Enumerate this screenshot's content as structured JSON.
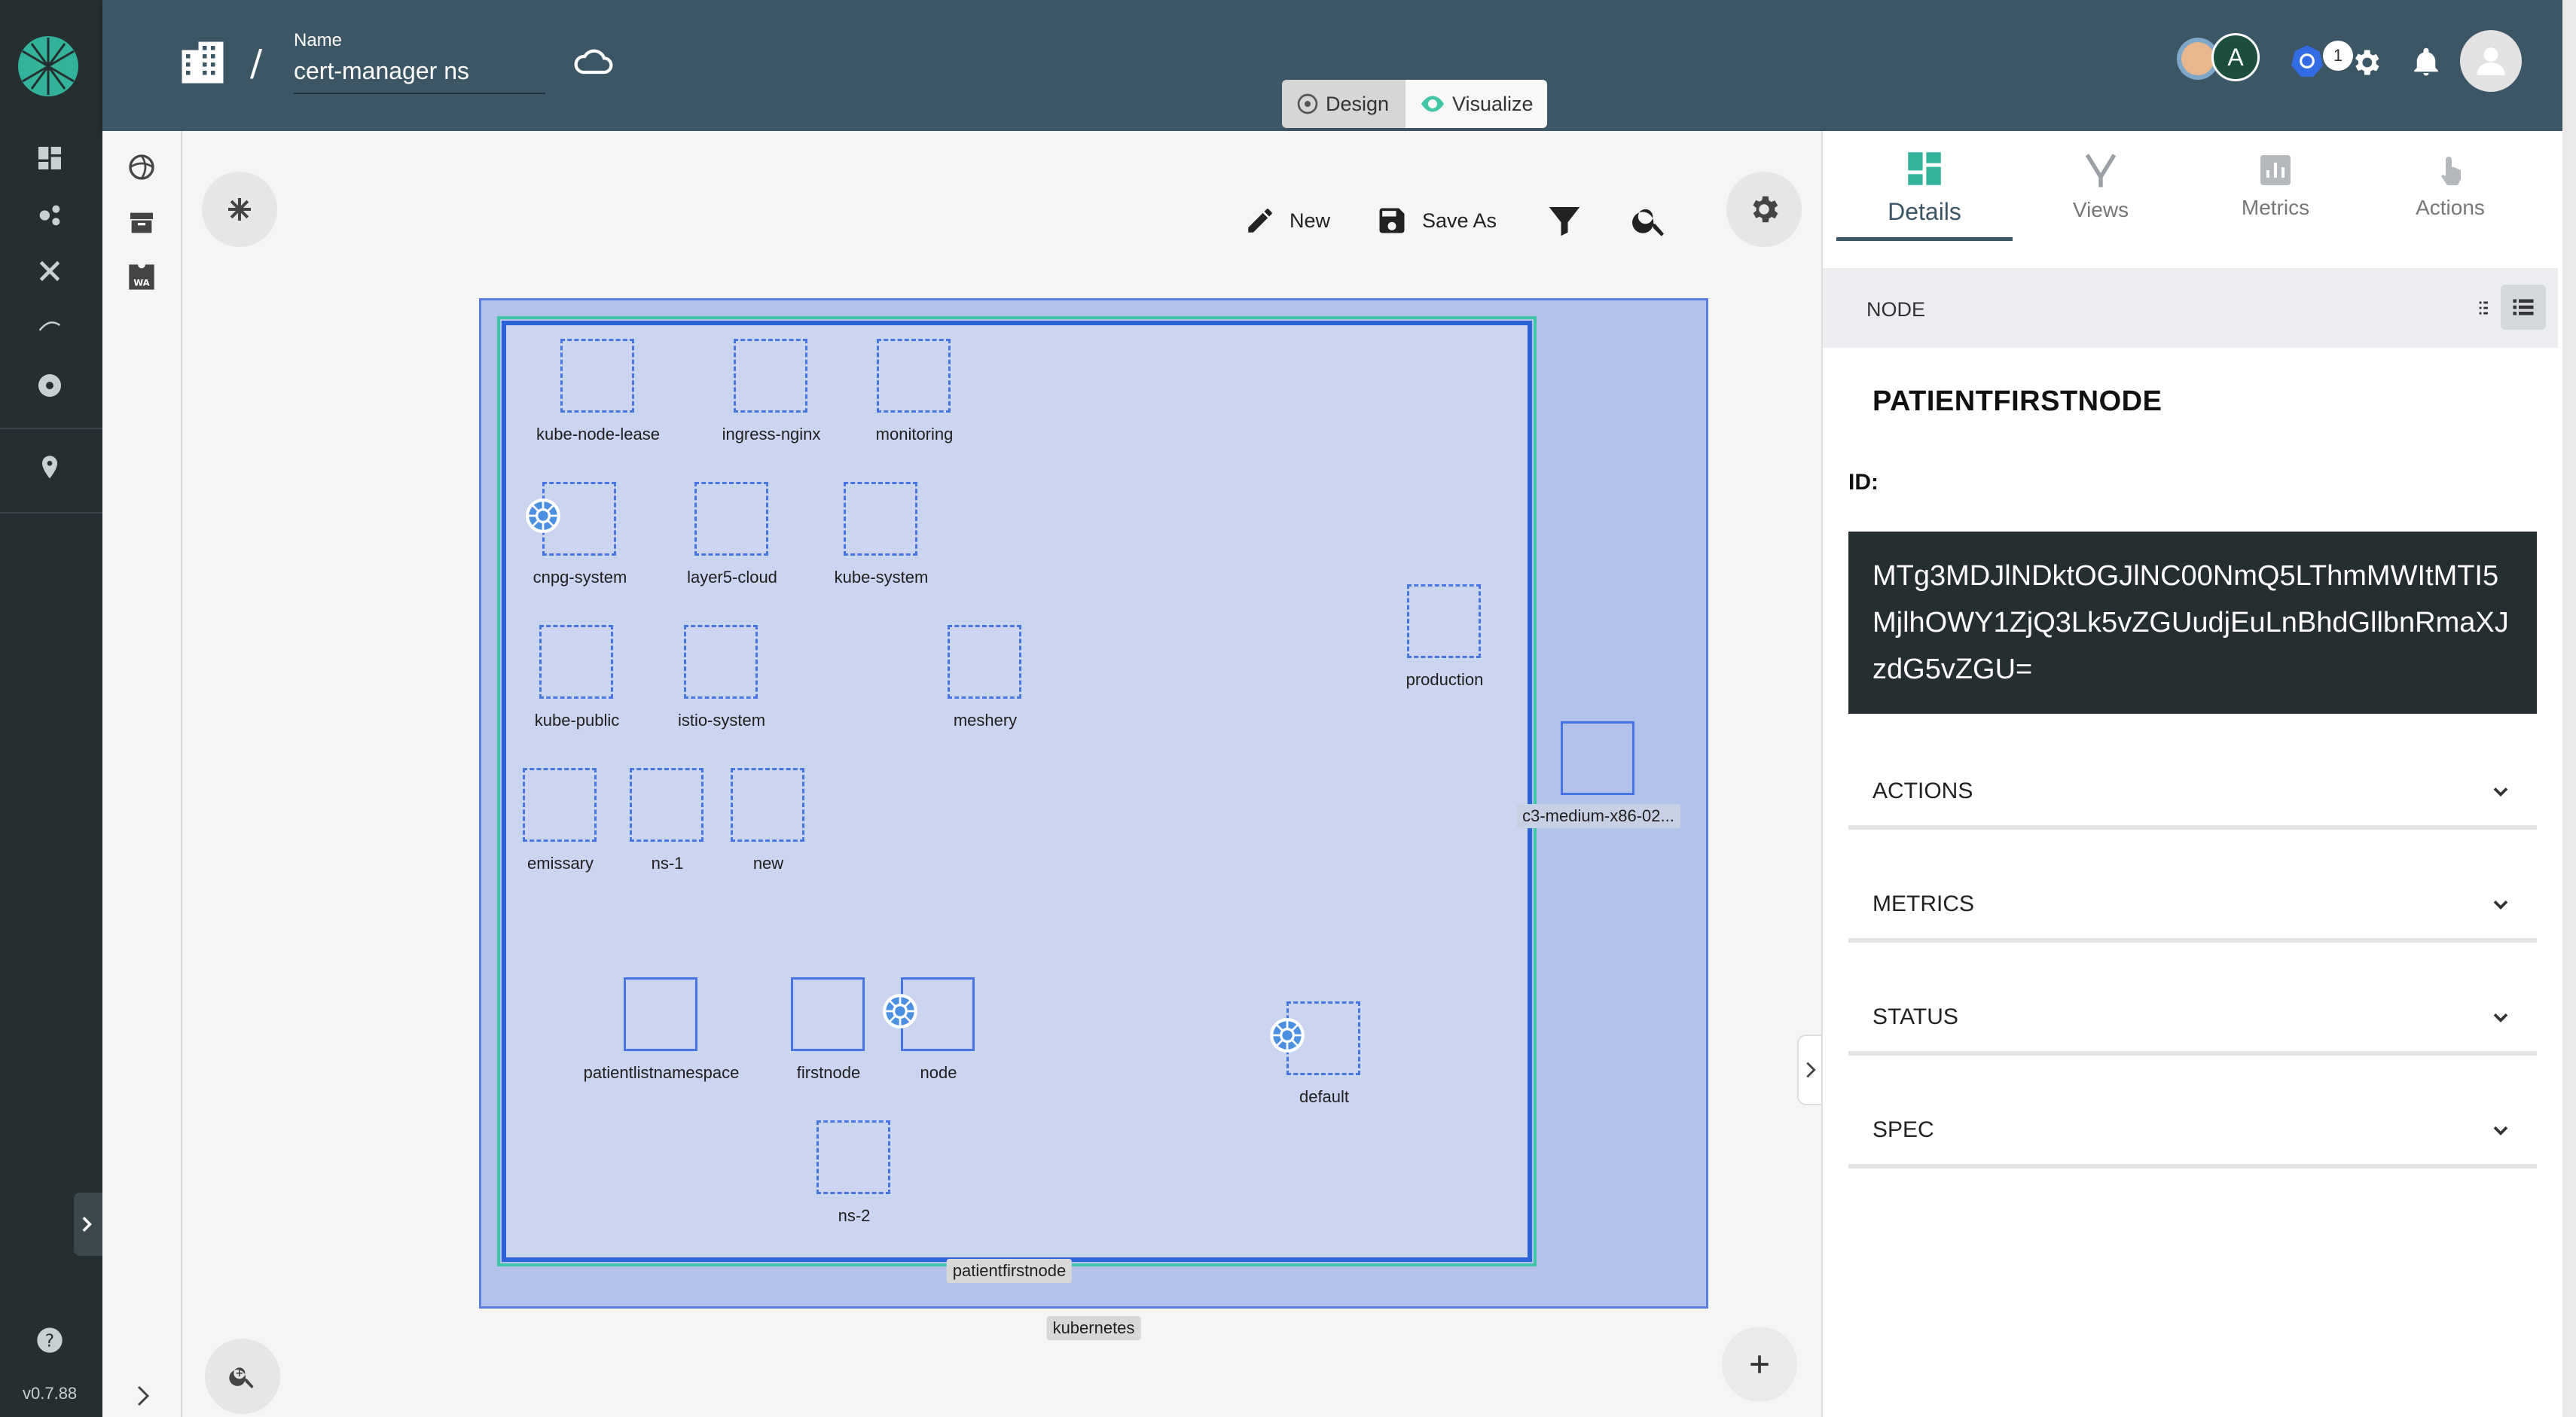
{
  "app": {
    "version": "v0.7.88"
  },
  "header": {
    "name_label": "Name",
    "name_value": "cert-manager ns",
    "notification_count": "1",
    "avatar_letter": "A"
  },
  "mode_toggle": {
    "design_label": "Design",
    "visualize_label": "Visualize"
  },
  "toolbar": {
    "new_label": "New",
    "save_as_label": "Save As"
  },
  "graph": {
    "cluster_label": "kubernetes",
    "node_label": "patientfirstnode",
    "external_node_label": "c3-medium-x86-02...",
    "namespaces": [
      "kube-node-lease",
      "ingress-nginx",
      "monitoring",
      "cnpg-system",
      "layer5-cloud",
      "kube-system",
      "kube-public",
      "istio-system",
      "meshery",
      "emissary",
      "ns-1",
      "new",
      "production",
      "patientlistnamespace",
      "firstnode",
      "node",
      "default",
      "ns-2"
    ]
  },
  "panel": {
    "tabs": [
      "Details",
      "Views",
      "Metrics",
      "Actions"
    ],
    "section_label": "NODE",
    "title": "PATIENTFIRSTNODE",
    "id_label": "ID:",
    "id_value": "MTg3MDJlNDktOGJlNC00NmQ5LThmMWItMTI5MjlhOWY1ZjQ3Lk5vZGUudjEuLnBhdGllbnRmaXJzdG5vZGU=",
    "accordions": [
      "ACTIONS",
      "METRICS",
      "STATUS",
      "SPEC"
    ]
  },
  "colors": {
    "header_bg": "#3d5666",
    "rail_bg": "#252e31",
    "cluster_bg": "#b3c2eb",
    "node_border": "#2d63d8",
    "accent_green": "#40c6a6"
  }
}
